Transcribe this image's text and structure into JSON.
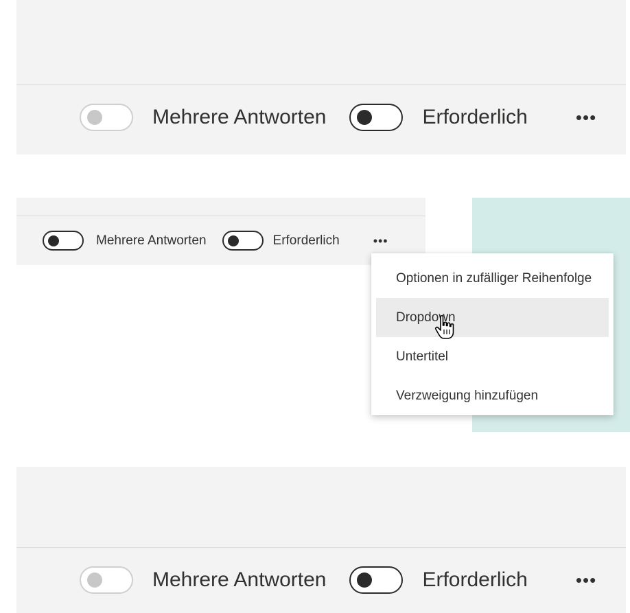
{
  "top_toolbar": {
    "toggle_multiple_label": "Mehrere Antworten",
    "toggle_required_label": "Erforderlich",
    "more_label": "•••",
    "multiple_enabled": false,
    "required_enabled": false
  },
  "middle_toolbar": {
    "toggle_multiple_label": "Mehrere Antworten",
    "toggle_required_label": "Erforderlich",
    "more_label": "•••"
  },
  "context_menu": {
    "items": [
      {
        "label": "Optionen in zufälliger Reihenfolge"
      },
      {
        "label": "Dropdown",
        "hovered": true
      },
      {
        "label": "Untertitel"
      },
      {
        "label": "Verzweigung hinzufügen"
      }
    ]
  },
  "bottom_toolbar": {
    "toggle_multiple_label": "Mehrere Antworten",
    "toggle_required_label": "Erforderlich",
    "more_label": "•••"
  },
  "colors": {
    "panel": "#f3f3f3",
    "accent_teal": "#d4ece9",
    "menu_hover": "#ebebeb",
    "text": "#323130"
  },
  "icons": {
    "cursor": "hand-pointer-icon",
    "more": "ellipsis-icon"
  }
}
